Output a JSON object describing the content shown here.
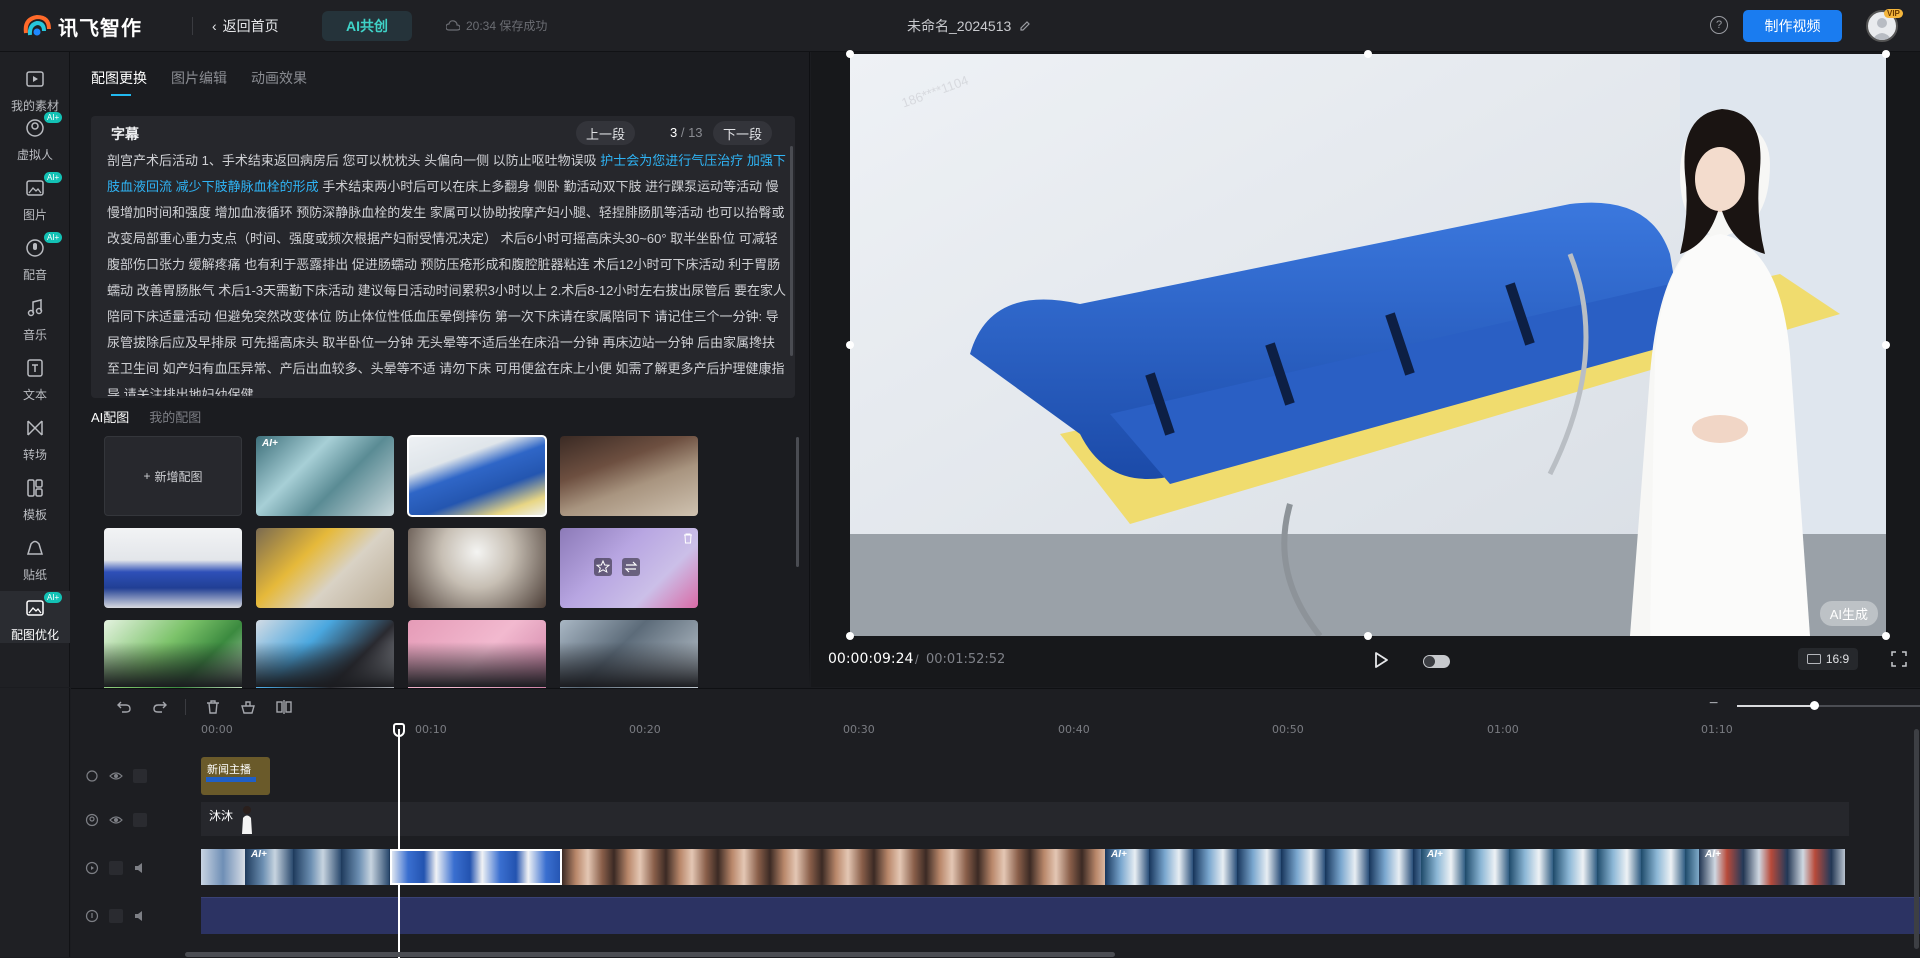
{
  "topbar": {
    "logo_text": "讯飞智作",
    "back_label": "返回首页",
    "ai_label": "AI共创",
    "save_status": "20:34 保存成功",
    "doc_title": "未命名_2024513",
    "help_icon": "?",
    "make_video_label": "制作视频",
    "vip_label": "VIP"
  },
  "rail": {
    "items": [
      {
        "label": "我的素材",
        "icon": "play-square-icon",
        "ai": false
      },
      {
        "label": "虚拟人",
        "icon": "avatar-icon",
        "ai": true
      },
      {
        "label": "图片",
        "icon": "image-icon",
        "ai": true
      },
      {
        "label": "配音",
        "icon": "voice-icon",
        "ai": true
      },
      {
        "label": "音乐",
        "icon": "music-icon",
        "ai": false
      },
      {
        "label": "文本",
        "icon": "text-icon",
        "ai": false
      },
      {
        "label": "转场",
        "icon": "transition-icon",
        "ai": false
      },
      {
        "label": "模板",
        "icon": "template-icon",
        "ai": false
      },
      {
        "label": "贴纸",
        "icon": "sticker-icon",
        "ai": false
      },
      {
        "label": "配图优化",
        "icon": "image-optimize-icon",
        "ai": true
      }
    ],
    "ai_badge": "AI+"
  },
  "editor": {
    "tabs": [
      "配图更换",
      "图片编辑",
      "动画效果"
    ],
    "subtitle": {
      "heading": "字幕",
      "prev_label": "上一段",
      "next_label": "下一段",
      "current": "3",
      "sep": " / ",
      "total": "13",
      "text_before": "剖宫产术后活动 1、手术结束返回病房后 您可以枕枕头 头偏向一侧 以防止呕吐物误吸 ",
      "text_highlight": "护士会为您进行气压治疗 加强下肢血液回流 减少下肢静脉血栓的形成",
      "text_after": " 手术结束两小时后可以在床上多翻身 侧卧 勤活动双下肢 进行踝泵运动等活动 慢慢增加时间和强度 增加血液循环 预防深静脉血栓的发生 家属可以协助按摩产妇小腿、轻捏腓肠肌等活动 也可以抬臀或改变局部重心重力支点（时间、强度或频次根据产妇耐受情况决定） 术后6小时可摇高床头30~60° 取半坐卧位 可减轻腹部伤口张力 缓解疼痛 也有利于恶露排出 促进肠蠕动 预防压疮形成和腹腔脏器粘连 术后12小时可下床活动 利于胃肠蠕动 改善胃肠胀气 术后1-3天需勤下床活动 建议每日活动时间累积3小时以上 2.术后8-12小时左右拔出尿管后 要在家人陪同下床适量活动 但避免突然改变体位 防止体位性低血压晕倒摔伤 第一次下床请在家属陪同下 请记住三个一分钟: 导尿管拔除后应及早排尿 可先摇高床头 取半卧位一分钟 无头晕等不适后坐在床沿一分钟 再床边站一分钟 后由家属搀扶至卫生间 如产妇有血压异常、产后出血较多、头晕等不适 请勿下床 可用便盆在床上小便 如需了解更多产后护理健康指导 请关注排出地妇幼保健"
    },
    "image_tabs": [
      "AI配图",
      "我的配图"
    ],
    "add_image_label": "新增配图",
    "ai_tag": "AI+"
  },
  "preview": {
    "current_time": "00:00:09:24",
    "time_sep": "/",
    "total_time": "00:01:52:52",
    "ai_gen_label": "AI生成",
    "ratio_label": "16:9",
    "watermark": "186****1104"
  },
  "timeline": {
    "ticks": [
      "00:00",
      "00:10",
      "00:20",
      "00:30",
      "00:40",
      "00:50",
      "01:00",
      "01:10"
    ],
    "news_clip_label": "新闻主播",
    "host_label": "沐沐",
    "ai_tag": "AI+"
  },
  "colors": {
    "accent": "#1a7cf0",
    "highlight_text": "#2fb4f5",
    "ai_badge": "#13c2b5",
    "audio_track": "#2c3363"
  }
}
